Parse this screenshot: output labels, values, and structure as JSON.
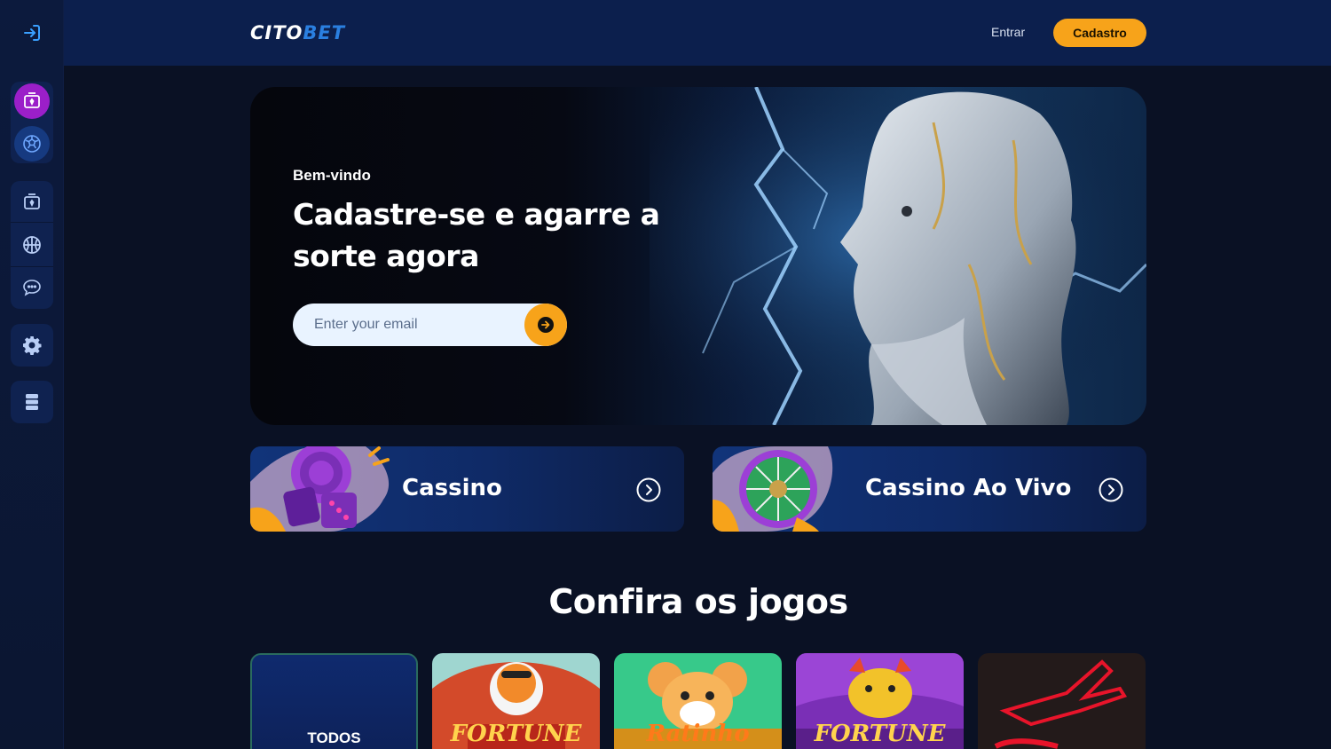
{
  "header": {
    "logo_part1": "CITO",
    "logo_part2": "BET",
    "login_label": "Entrar",
    "signup_label": "Cadastro"
  },
  "sidebar": {
    "icons": [
      "login-icon",
      "cards-icon",
      "soccer-ball-icon",
      "cards-icon",
      "basketball-icon",
      "chat-icon",
      "gear-icon",
      "ticket-icon"
    ]
  },
  "hero": {
    "welcome": "Bem-vindo",
    "title": "Cadastre-se e agarre a sorte agora",
    "email_placeholder": "Enter your email"
  },
  "categories": [
    {
      "label": "Cassino"
    },
    {
      "label": "Cassino Ao Vivo"
    }
  ],
  "games_section": {
    "title": "Confira os jogos",
    "tiles": [
      {
        "label": "TODOS"
      },
      {
        "label": "FORTUNE"
      },
      {
        "label": "Ratinho"
      },
      {
        "label": "FORTUNE"
      },
      {
        "label": ""
      }
    ]
  },
  "colors": {
    "accent": "#f7a31a",
    "background": "#0a1124",
    "header": "#0c1f4d",
    "sidebar_active": "#9b1fc9"
  }
}
